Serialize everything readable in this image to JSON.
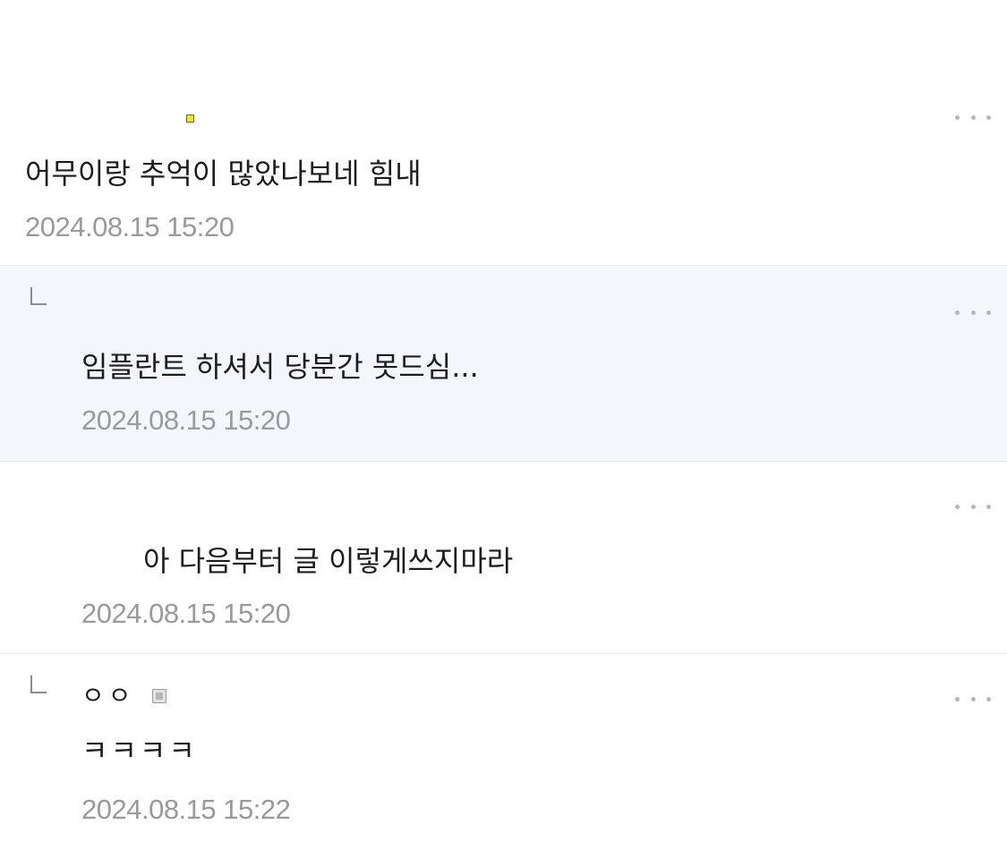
{
  "comments": [
    {
      "text": "어무이랑 추억이 많았나보네 힘내",
      "time": "2024.08.15 15:20",
      "is_reply": false
    },
    {
      "text": "임플란트 하셔서 당분간 못드심...",
      "time": "2024.08.15 15:20",
      "is_reply": true
    },
    {
      "text": "아 다음부터 글 이렇게쓰지마라",
      "time": "2024.08.15 15:20",
      "is_reply": false
    },
    {
      "author": "ㅇㅇ",
      "text": "ㅋㅋㅋㅋ",
      "time": "2024.08.15 15:22",
      "is_reply": true
    }
  ],
  "icons": {
    "more": "more-options-icon",
    "reply": "reply-arrow-icon",
    "badge": "member-badge-icon"
  },
  "colors": {
    "highlight_bg": "#f3f6fb",
    "timestamp": "#9a9a9a",
    "text": "#1d1d1d",
    "more_dots": "#b7b7b7"
  }
}
